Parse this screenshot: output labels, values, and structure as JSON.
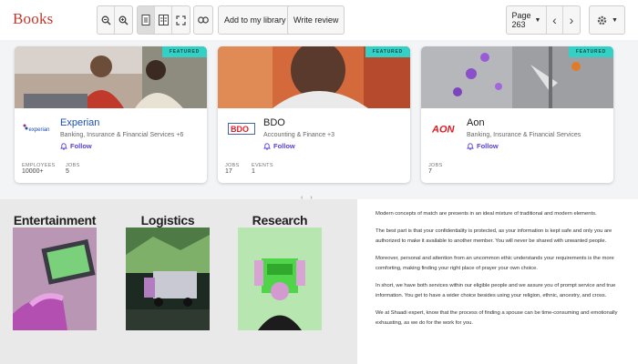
{
  "app": {
    "title": "Books"
  },
  "toolbar": {
    "add_to_library_label": "Add to my library",
    "write_review_label": "Write review",
    "page_label": "Page 263"
  },
  "cards": [
    {
      "name": "Experian",
      "logo_text": "experian",
      "industry": "Banking, Insurance & Financial Services +6",
      "follow": "Follow",
      "featured": "FEATURED",
      "stats": [
        {
          "label": "EMPLOYEES",
          "value": "10000+"
        },
        {
          "label": "JOBS",
          "value": "5"
        }
      ]
    },
    {
      "name": "BDO",
      "logo_text": "BDO",
      "industry": "Accounting & Finance +3",
      "follow": "Follow",
      "featured": "FEATURED",
      "stats": [
        {
          "label": "JOBS",
          "value": "17"
        },
        {
          "label": "EVENTS",
          "value": "1"
        }
      ]
    },
    {
      "name": "Aon",
      "logo_text": "AON",
      "industry": "Banking, Insurance & Financial Services",
      "follow": "Follow",
      "featured": "FEATURED",
      "stats": [
        {
          "label": "JOBS",
          "value": "7"
        }
      ]
    }
  ],
  "categories": [
    {
      "title": "Entertainment"
    },
    {
      "title": "Logistics"
    },
    {
      "title": "Research"
    }
  ],
  "article": {
    "paragraphs": [
      "Modern concepts of match are presents in an ideal mixture of traditional and modern elements.",
      "The best part is that your confidentiality is protected, as your information is kept safe and only you are authorized to make it available to another member. You will never be shared with unwanted people.",
      "Moreover, personal and attention from an uncommon ethic understands your requirements is the more comforting, making finding your right place of prayer your own choice.",
      "In short, we have both services within our eligible people and we assure you of prompt service and true information. You get to have a wider choice besides using your religion, ethnic, ancestry, and cross.",
      "We at Shaadi expert, know that the process of finding a spouse can be time-consuming and emotionally exhausting, as we do for the work for you."
    ]
  },
  "colors": {
    "brand": "#c0392b",
    "featured": "#34d0c6",
    "follow": "#5b3fd6",
    "experian": "#1b4fb5",
    "bdo": "#e31e24",
    "aon": "#e11b22"
  }
}
